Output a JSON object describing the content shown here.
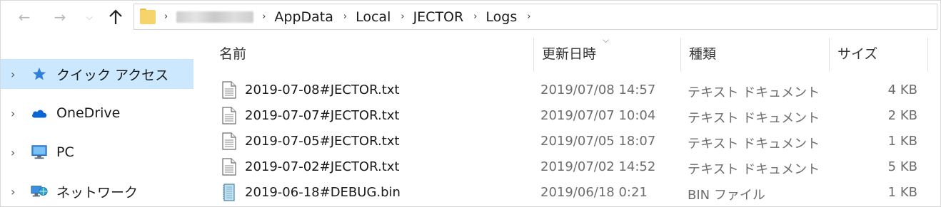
{
  "address_bar": {
    "breadcrumbs": [
      "AppData",
      "Local",
      "JECTOR",
      "Logs"
    ],
    "separator": "›"
  },
  "nav_pane": {
    "items": [
      {
        "label": "クイック アクセス",
        "icon": "star-icon",
        "selected": true
      },
      {
        "label": "OneDrive",
        "icon": "cloud-icon",
        "selected": false
      },
      {
        "label": "PC",
        "icon": "computer-icon",
        "selected": false
      },
      {
        "label": "ネットワーク",
        "icon": "network-icon",
        "selected": false
      }
    ]
  },
  "file_list": {
    "columns": {
      "name": "名前",
      "modified": "更新日時",
      "type": "種類",
      "size": "サイズ"
    },
    "sorted_by": "modified",
    "rows": [
      {
        "name": "2019-07-08#JECTOR.txt",
        "modified": "2019/07/08 14:57",
        "type": "テキスト ドキュメント",
        "size": "4 KB",
        "icon": "text-file-icon"
      },
      {
        "name": "2019-07-07#JECTOR.txt",
        "modified": "2019/07/07 10:04",
        "type": "テキスト ドキュメント",
        "size": "2 KB",
        "icon": "text-file-icon"
      },
      {
        "name": "2019-07-05#JECTOR.txt",
        "modified": "2019/07/05 18:07",
        "type": "テキスト ドキュメント",
        "size": "1 KB",
        "icon": "text-file-icon"
      },
      {
        "name": "2019-07-02#JECTOR.txt",
        "modified": "2019/07/02 14:52",
        "type": "テキスト ドキュメント",
        "size": "5 KB",
        "icon": "text-file-icon"
      },
      {
        "name": "2019-06-18#DEBUG.bin",
        "modified": "2019/06/18 0:21",
        "type": "BIN ファイル",
        "size": "1 KB",
        "icon": "binary-file-icon"
      }
    ]
  },
  "colors": {
    "selection": "#cce8ff",
    "folder": "#f7d36b",
    "onedrive": "#0a64d4",
    "quick_access_star": "#2f7ed8"
  }
}
